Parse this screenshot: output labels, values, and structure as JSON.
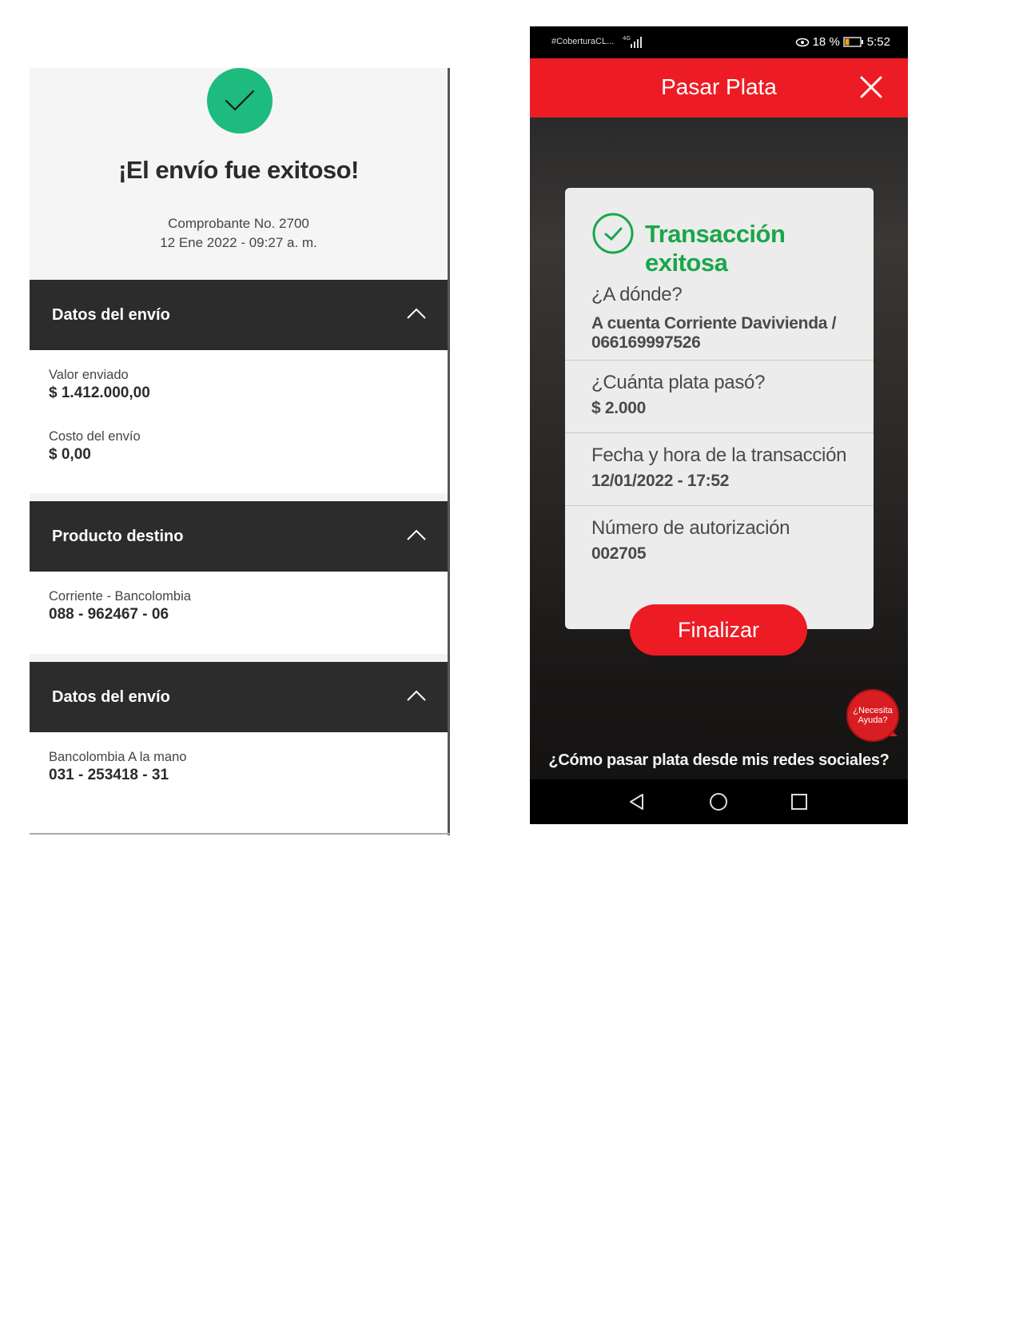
{
  "left_panel": {
    "title": "¡El envío fue exitoso!",
    "receipt": "Comprobante No. 2700",
    "datetime": "12 Ene 2022 - 09:27 a. m.",
    "sections": [
      {
        "header": "Datos del envío",
        "fields": [
          {
            "label": "Valor enviado",
            "value": "$ 1.412.000,00"
          },
          {
            "label": "Costo del envío",
            "value": "$ 0,00"
          }
        ]
      },
      {
        "header": "Producto destino",
        "fields": [
          {
            "label": "Corriente - Bancolombia",
            "value": "088 - 962467 - 06"
          }
        ]
      },
      {
        "header": "Datos del envío",
        "fields": [
          {
            "label": "Bancolombia A la mano",
            "value": "031 - 253418 - 31"
          }
        ]
      }
    ],
    "colors": {
      "success": "#1dbb7e",
      "header_bg": "#2c2c2c"
    }
  },
  "right_panel": {
    "status_bar": {
      "carrier": "#CoberturaCL...",
      "network": "4G",
      "battery": "18 %",
      "time": "5:52"
    },
    "app_title": "Pasar Plata",
    "card": {
      "title": "Transacción exitosa",
      "rows": [
        {
          "label": "¿A dónde?",
          "value_lines": [
            "A cuenta Corriente Davivienda /",
            "066169997526"
          ]
        },
        {
          "label": "¿Cuánta plata pasó?",
          "value_lines": [
            "$ 2.000"
          ]
        },
        {
          "label": "Fecha y hora de la transacción",
          "value_lines": [
            "12/01/2022 - 17:52"
          ]
        },
        {
          "label": "Número de autorización",
          "value_lines": [
            "002705"
          ]
        }
      ]
    },
    "finish_label": "Finalizar",
    "help_label": [
      "¿Necesita",
      "Ayuda?"
    ],
    "social_link": "¿Cómo pasar plata desde mis redes sociales?",
    "nav_icons": [
      "back-icon",
      "home-icon",
      "recents-icon"
    ],
    "colors": {
      "brand_red": "#ed1c24",
      "success_green": "#1aa64a"
    }
  }
}
